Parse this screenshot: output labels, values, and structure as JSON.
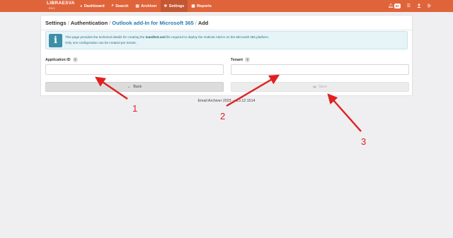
{
  "navbar": {
    "brand_name": "LIBRAESVA",
    "brand_sub": "ESG",
    "items": [
      {
        "label": "Dashboard",
        "icon": "dashboard-icon",
        "glyph": "◕"
      },
      {
        "label": "Search",
        "icon": "search-icon",
        "glyph": "⌕"
      },
      {
        "label": "Archiver",
        "icon": "archive-icon",
        "glyph": "▤"
      },
      {
        "label": "Settings",
        "icon": "gear-icon",
        "glyph": "✲"
      },
      {
        "label": "Reports",
        "icon": "reports-icon",
        "glyph": "▦"
      }
    ],
    "active_item": "Settings",
    "notifications_count": "82",
    "accent_color": "#e0643a"
  },
  "breadcrumb": {
    "level1": "Settings",
    "level2": "Authentication",
    "level3": "Outlook add-In for Microsoft 365",
    "current": "Add",
    "separator": "/"
  },
  "info": {
    "line1_prefix": "This page provides the technical details for creating the",
    "line1_file": "manifest.xml",
    "line1_suffix": "file required to deploy the Outlook Add-in on the Microsoft 365 platform.",
    "line2": "Only one configuration can be created per tenant."
  },
  "form": {
    "application_id_label": "Application ID",
    "application_id_value": "",
    "tenant_label": "Tenant",
    "tenant_value": "",
    "help_glyph": "?",
    "back_label": "Back",
    "save_label": "Save"
  },
  "footer": {
    "text": "Email Archiver 2023 - v23.12.1514"
  },
  "annotations": {
    "labels": [
      "1",
      "2",
      "3"
    ],
    "color": "#e02020"
  }
}
